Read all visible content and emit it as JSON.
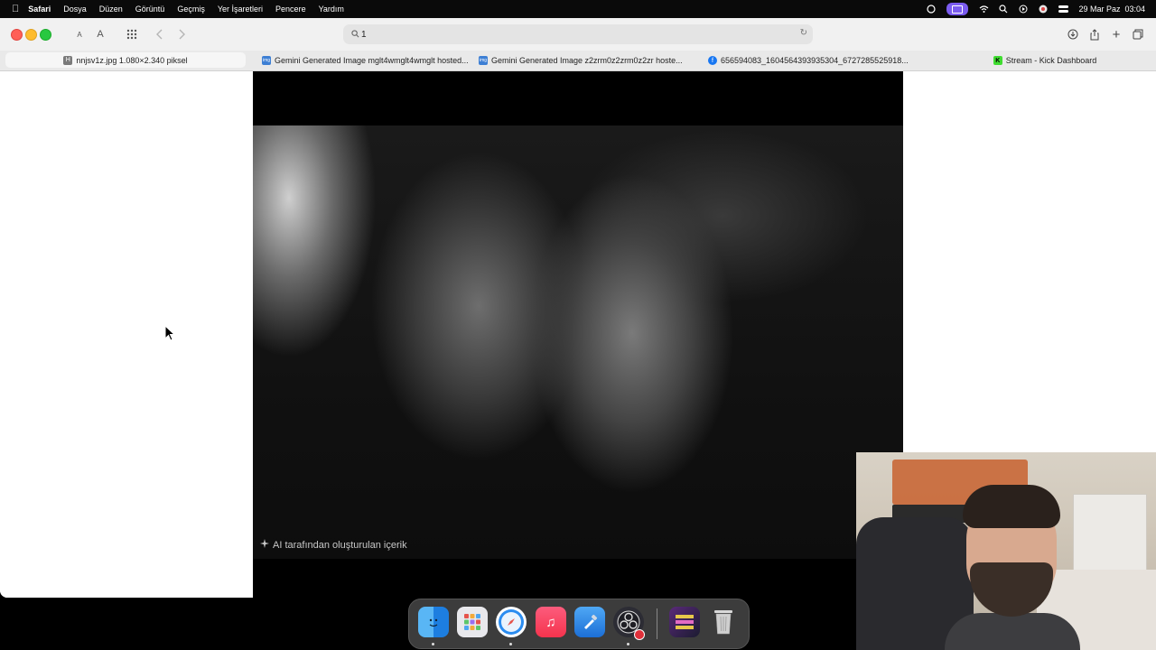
{
  "menubar": {
    "apple_icon": "apple-icon",
    "items": [
      "Safari",
      "Dosya",
      "Düzen",
      "Görüntü",
      "Geçmiş",
      "Yer İşaretleri",
      "Pencere",
      "Yardım"
    ],
    "datetime": "29 Mar Paz  03:04"
  },
  "toolbar": {
    "text_small": "A",
    "text_large": "A",
    "address_value": "1"
  },
  "tabs": [
    {
      "label": "nnjsv1z.jpg 1.080×2.340 piksel",
      "favicon": "H",
      "favicon_color": "#7a7a7a"
    },
    {
      "label": "Gemini Generated Image mglt4wmglt4wmglt hosted...",
      "favicon": "img",
      "favicon_color": "#3d7fd4"
    },
    {
      "label": "Gemini Generated Image z2zrm0z2zrm0z2zr hoste...",
      "favicon": "img",
      "favicon_color": "#3d7fd4"
    },
    {
      "label": "656594083_1604564393935304_6727285525918...",
      "favicon": "f",
      "favicon_color": "#1877f2"
    },
    {
      "label": "Stream - Kick Dashboard",
      "favicon": "K",
      "favicon_color": "#3fdc30"
    }
  ],
  "image": {
    "ai_label": "AI tarafından oluşturulan içerik"
  },
  "dock": {
    "apps": [
      "Finder",
      "Launchpad",
      "Safari",
      "Music",
      "Xcode",
      "OBS",
      "Dumbo",
      "Trash"
    ]
  },
  "colors": {
    "accent": "#7b5cf0",
    "close": "#ff5f57",
    "minimize": "#febc2e",
    "maximize": "#28c840"
  }
}
